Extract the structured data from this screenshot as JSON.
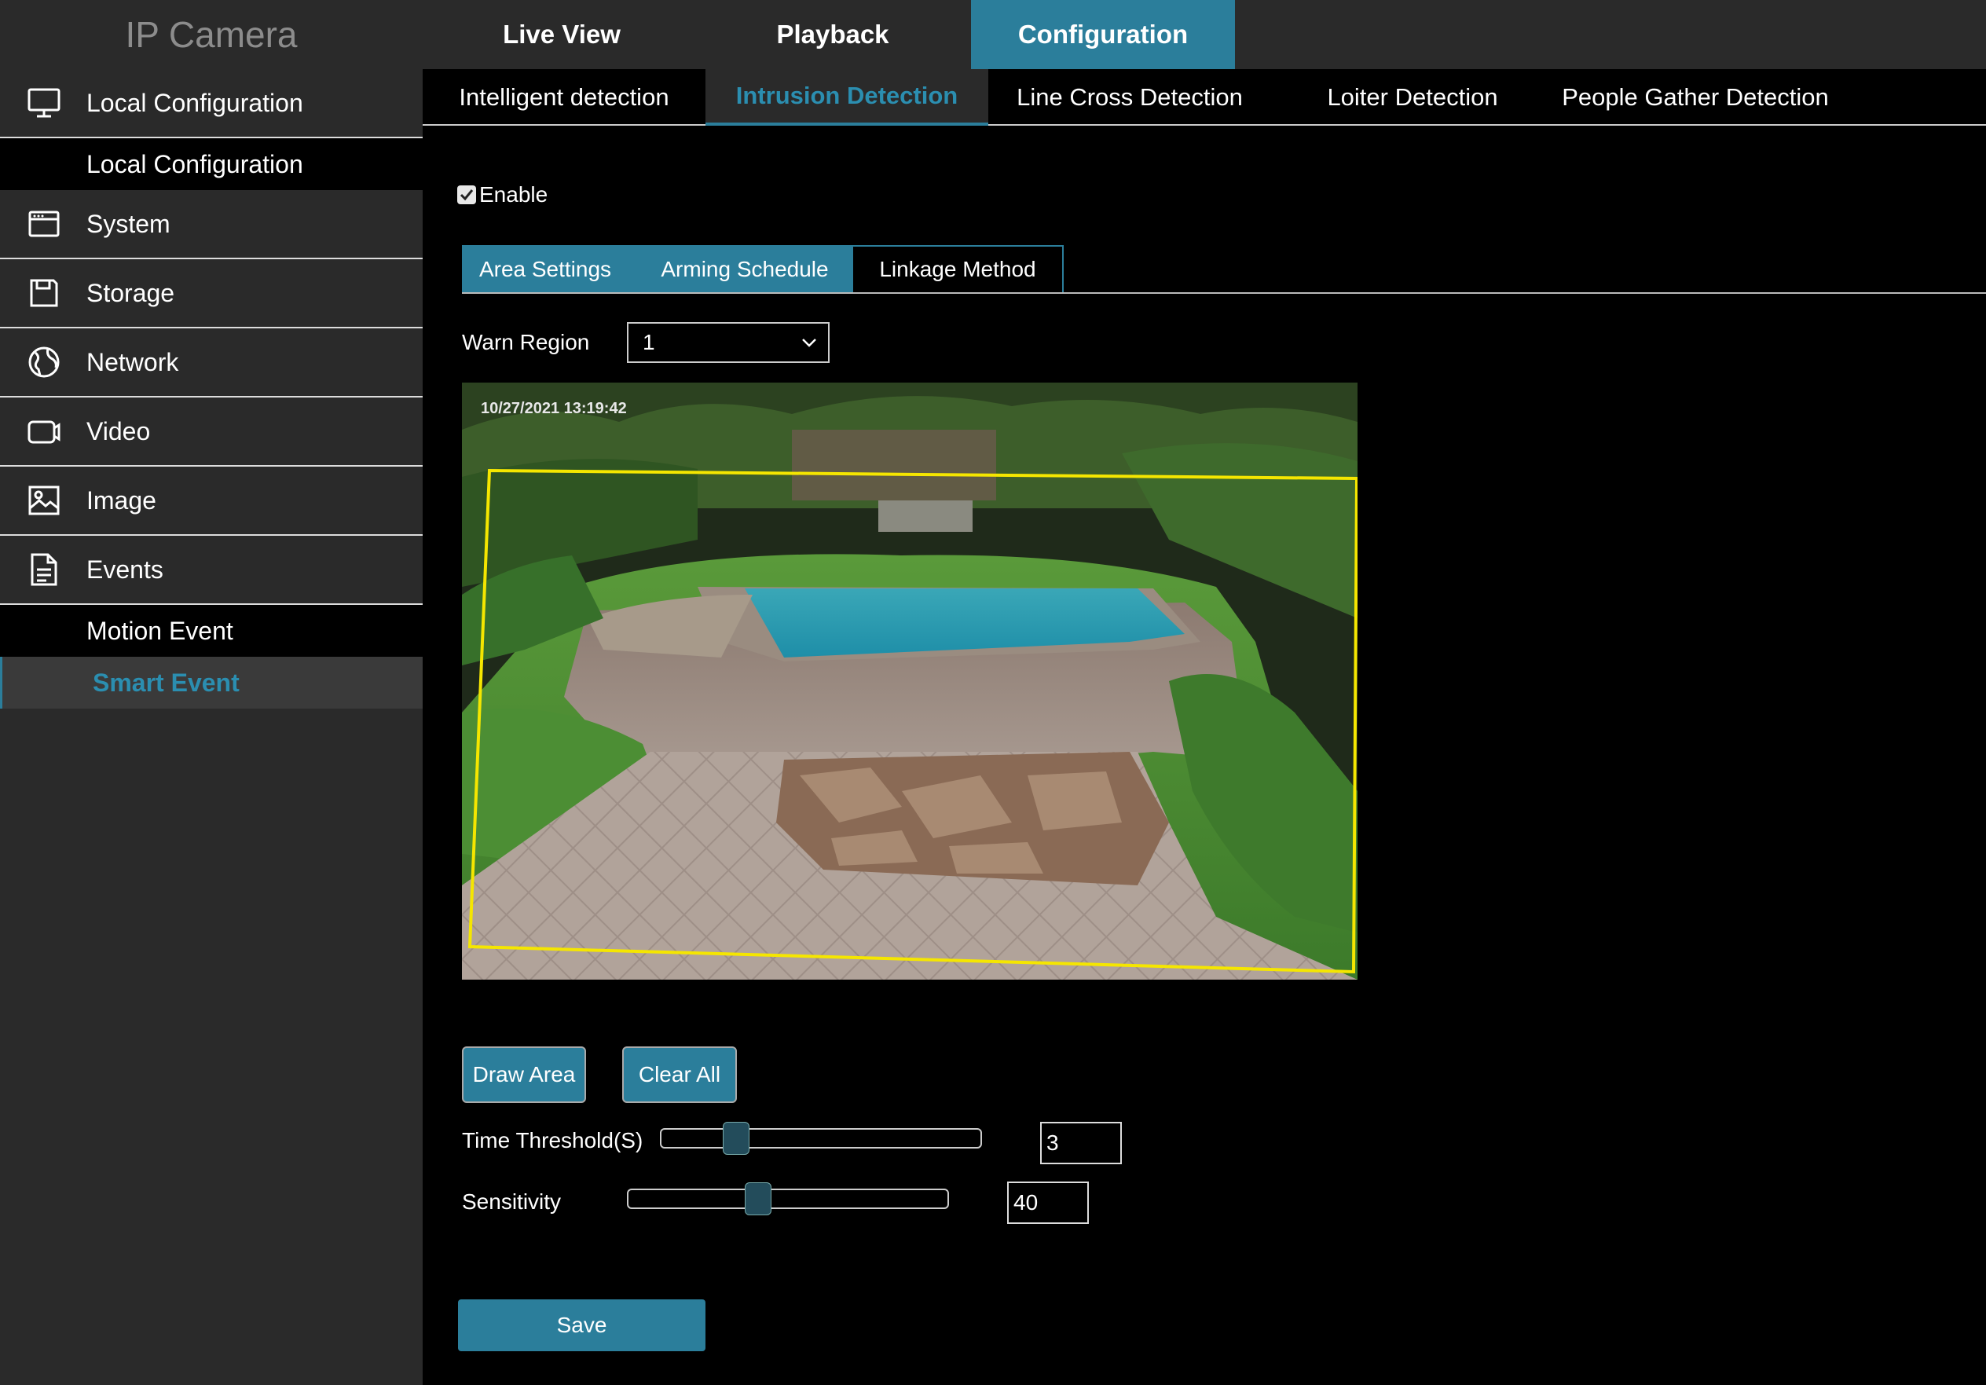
{
  "app": {
    "title": "IP Camera"
  },
  "topnav": {
    "live_view": "Live View",
    "playback": "Playback",
    "configuration": "Configuration"
  },
  "sidebar": {
    "local_configuration": "Local Configuration",
    "local_configuration_sub": "Local Configuration",
    "system": "System",
    "storage": "Storage",
    "network": "Network",
    "video": "Video",
    "image": "Image",
    "events": "Events",
    "motion_event": "Motion Event",
    "smart_event": "Smart Event"
  },
  "subtabs": {
    "intelligent": "Intelligent detection",
    "intrusion": "Intrusion Detection",
    "line_cross": "Line Cross Detection",
    "loiter": "Loiter Detection",
    "people_gather": "People Gather Detection"
  },
  "enable": {
    "label": "Enable",
    "checked": true
  },
  "innertabs": {
    "area_settings": "Area Settings",
    "arming_schedule": "Arming Schedule",
    "linkage_method": "Linkage Method"
  },
  "warn_region": {
    "label": "Warn Region",
    "value": "1"
  },
  "camera": {
    "timestamp": "10/27/2021  13:19:42",
    "region_color": "#f5e600"
  },
  "buttons": {
    "draw_area": "Draw Area",
    "clear_all": "Clear All",
    "save": "Save"
  },
  "time_threshold": {
    "label": "Time Threshold(S)",
    "value": "3"
  },
  "sensitivity": {
    "label": "Sensitivity",
    "value": "40"
  },
  "colors": {
    "accent": "#2b7e9b",
    "sidebar_bg": "#2a2a2a"
  }
}
